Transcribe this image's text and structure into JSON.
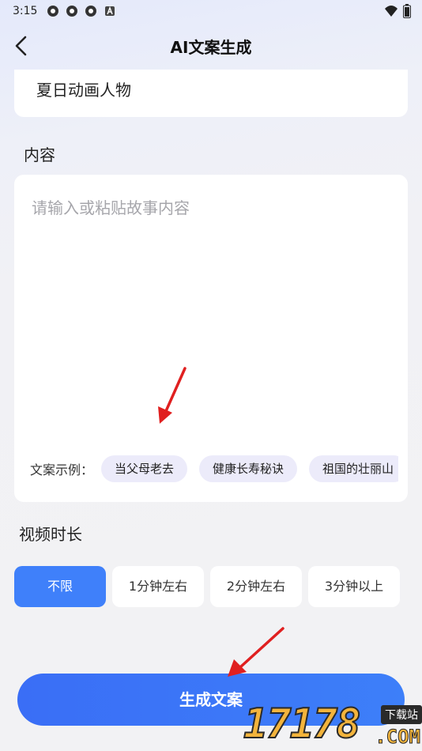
{
  "status_bar": {
    "time": "3:15",
    "notification_icons": [
      "app-notification-icon",
      "app-notification-icon",
      "app-notification-icon",
      "a-letter-icon"
    ],
    "right_icons": [
      "wifi-icon",
      "battery-icon"
    ]
  },
  "nav": {
    "title": "AI文案生成",
    "back_icon": "back-chevron-icon"
  },
  "title_field": {
    "value": "夏日动画人物"
  },
  "content_section": {
    "label": "内容",
    "placeholder": "请输入或粘贴故事内容",
    "examples_label": "文案示例：",
    "examples": [
      "当父母老去",
      "健康长寿秘诀",
      "祖国的壮丽山"
    ]
  },
  "duration_section": {
    "label": "视频时长",
    "options": [
      "不限",
      "1分钟左右",
      "2分钟左右",
      "3分钟以上"
    ],
    "selected": "不限"
  },
  "generate_button": {
    "label": "生成文案"
  },
  "watermark": {
    "digits": "17178",
    "badge": "下载站",
    "domain": ".COM"
  },
  "colors": {
    "accent": "#3f80fa",
    "chip_bg": "#ecebfa",
    "annotation_arrow": "#e02020"
  }
}
